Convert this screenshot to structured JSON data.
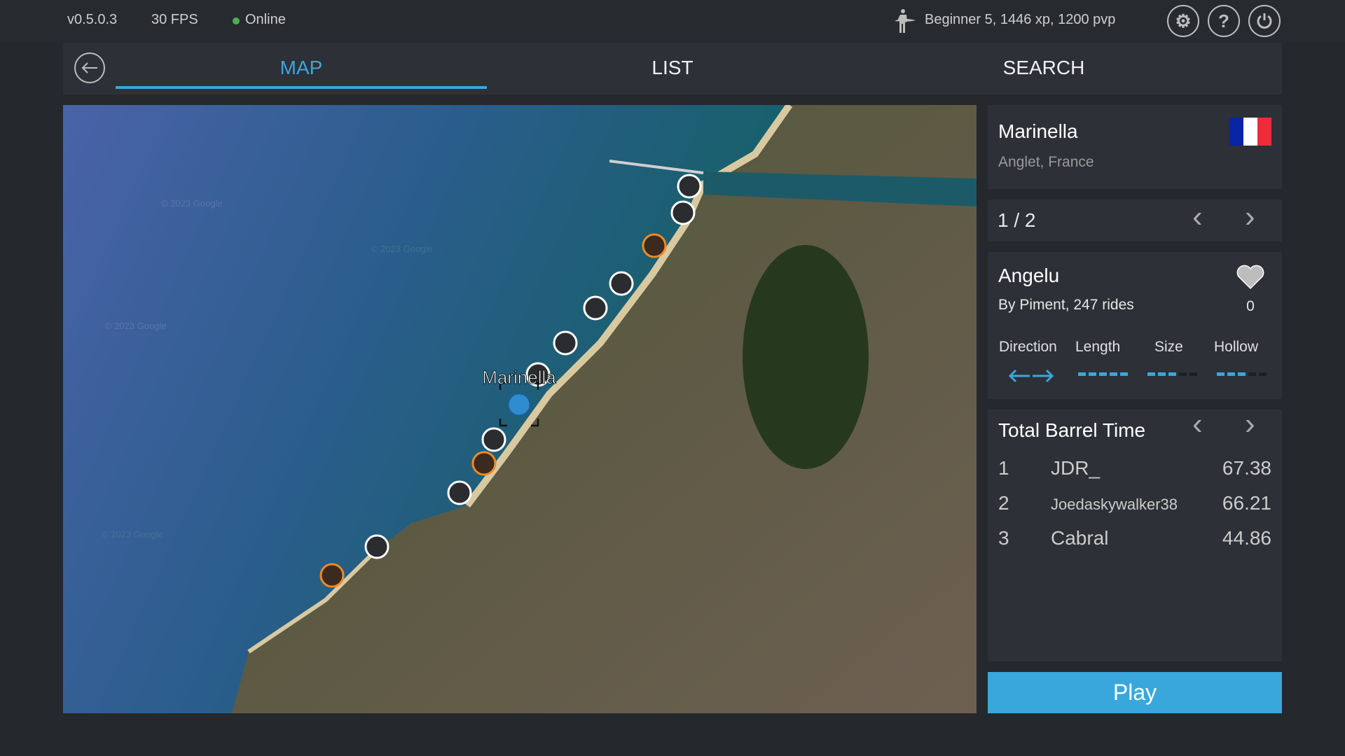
{
  "topbar": {
    "version": "v0.5.0.3",
    "fps": "30 FPS",
    "status": "Online",
    "status_color": "#4caf50",
    "player": "Beginner 5, 1446 xp, 1200 pvp",
    "icons": [
      "surfer-icon",
      "settings-icon",
      "help-icon",
      "power-icon"
    ]
  },
  "tabs": {
    "back_icon": "arrow-left-icon",
    "items": [
      {
        "label": "MAP",
        "active": true
      },
      {
        "label": "LIST"
      },
      {
        "label": "SEARCH"
      }
    ]
  },
  "map": {
    "selected_label": "Marinella",
    "watermark": "© 2023 Google"
  },
  "location": {
    "name": "Marinella",
    "region": "Anglet, France",
    "flag": "france-flag"
  },
  "pager": {
    "text": "1 / 2"
  },
  "spot": {
    "name": "Angelu",
    "byline": "By Piment, 247 rides",
    "likes": "0",
    "attributes": [
      {
        "label": "Direction"
      },
      {
        "label": "Length",
        "level": 5,
        "max": 5
      },
      {
        "label": "Size",
        "level": 3,
        "max": 5
      },
      {
        "label": "Hollow",
        "level": 3,
        "max": 5
      }
    ]
  },
  "leaderboard": {
    "title": "Total Barrel Time",
    "rows": [
      {
        "rank": "1",
        "name": "JDR_",
        "value": "67.38"
      },
      {
        "rank": "2",
        "name": "Joedaskywalker38",
        "value": "66.21"
      },
      {
        "rank": "3",
        "name": "Cabral",
        "value": "44.86"
      }
    ]
  },
  "play_label": "Play",
  "colors": {
    "accent": "#3aa7dc",
    "background": "#25282c",
    "panel": "#2d3036"
  }
}
